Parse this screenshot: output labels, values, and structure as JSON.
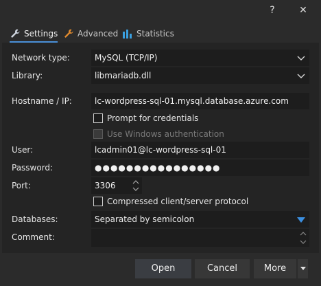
{
  "titlebar": {
    "help_label": "?",
    "close_label": "✕"
  },
  "tabs": [
    {
      "label": "Settings",
      "icon": "wrench-icon",
      "active": true
    },
    {
      "label": "Advanced",
      "icon": "wrench-orange-icon",
      "active": false
    },
    {
      "label": "Statistics",
      "icon": "bar-chart-icon",
      "active": false
    }
  ],
  "form": {
    "network_type": {
      "label": "Network type:",
      "value": "MySQL (TCP/IP)"
    },
    "library": {
      "label": "Library:",
      "value": "libmariadb.dll"
    },
    "hostname": {
      "label": "Hostname / IP:",
      "value": "lc-wordpress-sql-01.mysql.database.azure.com"
    },
    "prompt_credentials": {
      "label": "Prompt for credentials",
      "checked": false
    },
    "windows_auth": {
      "label": "Use Windows authentication",
      "checked": false,
      "disabled": true
    },
    "user": {
      "label": "User:",
      "value": "lcadmin01@lc-wordpress-sql-01"
    },
    "password": {
      "label": "Password:",
      "value": "●●●●●●●●●●●●●●●●"
    },
    "port": {
      "label": "Port:",
      "value": "3306"
    },
    "compressed": {
      "label": "Compressed client/server protocol",
      "checked": false
    },
    "databases": {
      "label": "Databases:",
      "value": "Separated by semicolon"
    },
    "comment": {
      "label": "Comment:",
      "value": ""
    }
  },
  "buttons": {
    "open": "Open",
    "cancel": "Cancel",
    "more": "More"
  },
  "colors": {
    "accent": "#4a90d9",
    "wrench_orange": "#e08a2e",
    "stats_blue": "#3aa0e0"
  }
}
